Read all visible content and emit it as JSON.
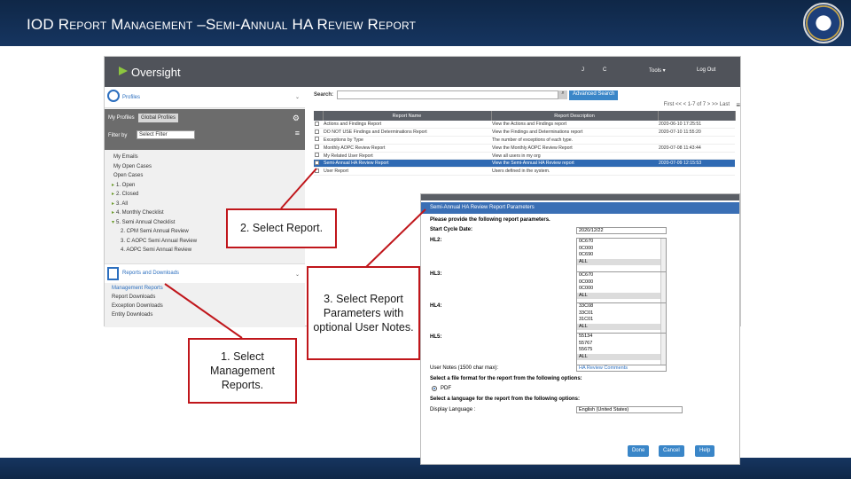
{
  "slide": {
    "title": "IOD Report Management –Semi-Annual HA Review Report"
  },
  "app": {
    "logo": "Oversight",
    "topnav": {
      "item_j": "J",
      "item_c": "C",
      "tools": "Tools ▾",
      "logout": "Log Out"
    },
    "profiles": {
      "header": "Profiles",
      "my_profiles": "My Profiles",
      "global_profiles": "Global Profiles",
      "filter_label": "Filter by",
      "filter_value": "Select Filter",
      "items": [
        {
          "label": "My Emails",
          "level": 1,
          "tri": ""
        },
        {
          "label": "My Open Cases",
          "level": 1,
          "tri": ""
        },
        {
          "label": "Open Cases",
          "level": 1,
          "tri": ""
        },
        {
          "label": "1. Open",
          "level": 1,
          "tri": "▸"
        },
        {
          "label": "2. Closed",
          "level": 1,
          "tri": "▸"
        },
        {
          "label": "3. All",
          "level": 1,
          "tri": "▸"
        },
        {
          "label": "4. Monthly Checklist",
          "level": 1,
          "tri": "▸"
        },
        {
          "label": "5. Semi Annual Checklist",
          "level": 1,
          "tri": "▾"
        },
        {
          "label": "2. CPM Semi Annual Review",
          "level": 2,
          "tri": ""
        },
        {
          "label": "3. C AOPC Semi Annual Review",
          "level": 2,
          "tri": ""
        },
        {
          "label": "4. AOPC Semi Annual Review",
          "level": 2,
          "tri": ""
        }
      ]
    },
    "reports": {
      "header": "Reports and Downloads",
      "items": [
        "Management Reports",
        "Report Downloads",
        "Exception Downloads",
        "Entity Downloads"
      ]
    },
    "search": {
      "label": "Search:",
      "value": "",
      "advanced": "Advanced Search",
      "pager": "First  <<  < 1-7 of 7  >  >>  Last"
    },
    "table": {
      "headers": [
        "Report Name",
        "Report Description",
        ""
      ],
      "rows": [
        {
          "name": "Actions and Findings Report",
          "desc": "View the Actions and Findings report",
          "date": "2020-06-10 17:25:51",
          "selected": false
        },
        {
          "name": "DO NOT USE Findings and Determinations Report",
          "desc": "View the Findings and Determinations report",
          "date": "2020-07-10 11:55:20",
          "selected": false
        },
        {
          "name": "Exceptions by Type",
          "desc": "The number of exceptions of each type.",
          "date": "",
          "selected": false
        },
        {
          "name": "Monthly AOPC Review Report",
          "desc": "View the Monthly AOPC Review Report",
          "date": "2020-07-08 11:43:44",
          "selected": false
        },
        {
          "name": "My Related User Report",
          "desc": "View all users in my org",
          "date": "",
          "selected": false
        },
        {
          "name": "Semi-Annual HA Review Report",
          "desc": "View the Semi-Annual HA Review report",
          "date": "2020-07-09 12:15:53",
          "selected": true
        },
        {
          "name": "User Report",
          "desc": "Users defined in the system.",
          "date": "",
          "selected": false
        }
      ]
    }
  },
  "params": {
    "title": "Semi-Annual HA Review Report Parameters",
    "prompt": "Please provide the following report parameters.",
    "start_label": "Start Cycle Date:",
    "start_value": "2020/12/22",
    "hl2_label": "HL2:",
    "hl2_options": [
      "0C670",
      "0C000",
      "0C690",
      "ALL"
    ],
    "hl3_label": "HL3:",
    "hl3_options": [
      "0C670",
      "0C000",
      "0C000",
      "ALL"
    ],
    "hl4_label": "HL4:",
    "hl4_options": [
      "33C08",
      "33C01",
      "31C01",
      "ALL"
    ],
    "hl5_label": "HL5:",
    "hl5_options": [
      "55134",
      "55767",
      "55675",
      "ALL"
    ],
    "notes_label": "User Notes (1500 char max):",
    "notes_value": "HA Review Comments",
    "format_label": "Select a file format for the report from the following options:",
    "format_option": "PDF",
    "language_label": "Select a language for the report from the following options:",
    "display_language_label": "Display Language :",
    "display_language_value": "English (United States)",
    "buttons": {
      "done": "Done",
      "cancel": "Cancel",
      "help": "Help"
    }
  },
  "callouts": {
    "step1": "1. Select Management Reports.",
    "step2": "2. Select Report.",
    "step3": "3. Select Report Parameters with optional User Notes."
  },
  "colors": {
    "header_navy": "#163560",
    "callout_red": "#c0161b",
    "app_bar": "#50535a",
    "accent_blue": "#3a86c8"
  }
}
